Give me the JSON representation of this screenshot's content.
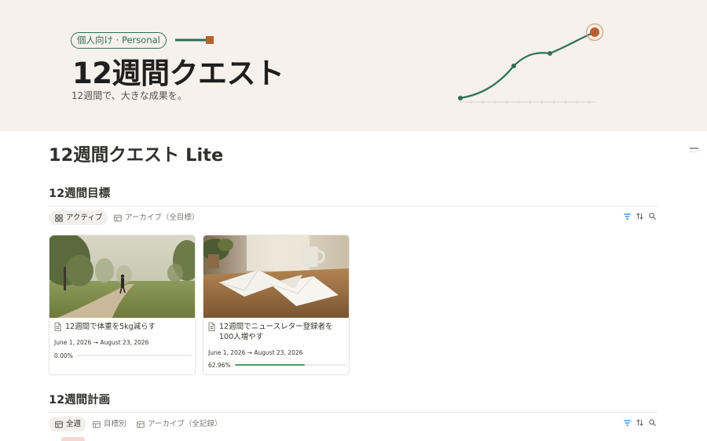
{
  "cover": {
    "tag": "個人向け · Personal",
    "title": "12週間クエスト",
    "subtitle": "12週間で、大きな成果を。",
    "bg_color": "#f6f1ea",
    "accent_green": "#2f6f57",
    "accent_orange": "#b5622c"
  },
  "page": {
    "title": "12週間クエスト Lite"
  },
  "goals": {
    "heading": "12週間目標",
    "views": [
      {
        "label": "アクティブ",
        "icon": "gallery-icon",
        "active": true
      },
      {
        "label": "アーカイブ（全目標）",
        "icon": "table-icon",
        "active": false
      }
    ],
    "tools": [
      "filter-icon",
      "sort-icon",
      "search-icon"
    ],
    "cards": [
      {
        "title": "12週間で体重を5kg減らす",
        "date_range": "June 1, 2026 → August 23, 2026",
        "progress_label": "0.00%",
        "progress": 0.0,
        "image": "misty-park-runner-photo"
      },
      {
        "title": "12週間でニュースレター登録者を100人増やす",
        "date_range": "June 1, 2026 → August 23, 2026",
        "progress_label": "62.96%",
        "progress": 0.6296,
        "image": "envelopes-on-table-photo"
      }
    ]
  },
  "plans": {
    "heading": "12週間計画",
    "views": [
      {
        "label": "全週",
        "icon": "table-icon",
        "active": true
      },
      {
        "label": "目標別",
        "icon": "table-icon",
        "active": false
      },
      {
        "label": "アーカイブ（全記録）",
        "icon": "table-icon",
        "active": false
      }
    ],
    "tools": [
      "filter-icon",
      "sort-icon",
      "search-icon"
    ]
  },
  "colors": {
    "progress_fill": "#4c9a6e",
    "filter_blue": "#2e7ad1"
  }
}
